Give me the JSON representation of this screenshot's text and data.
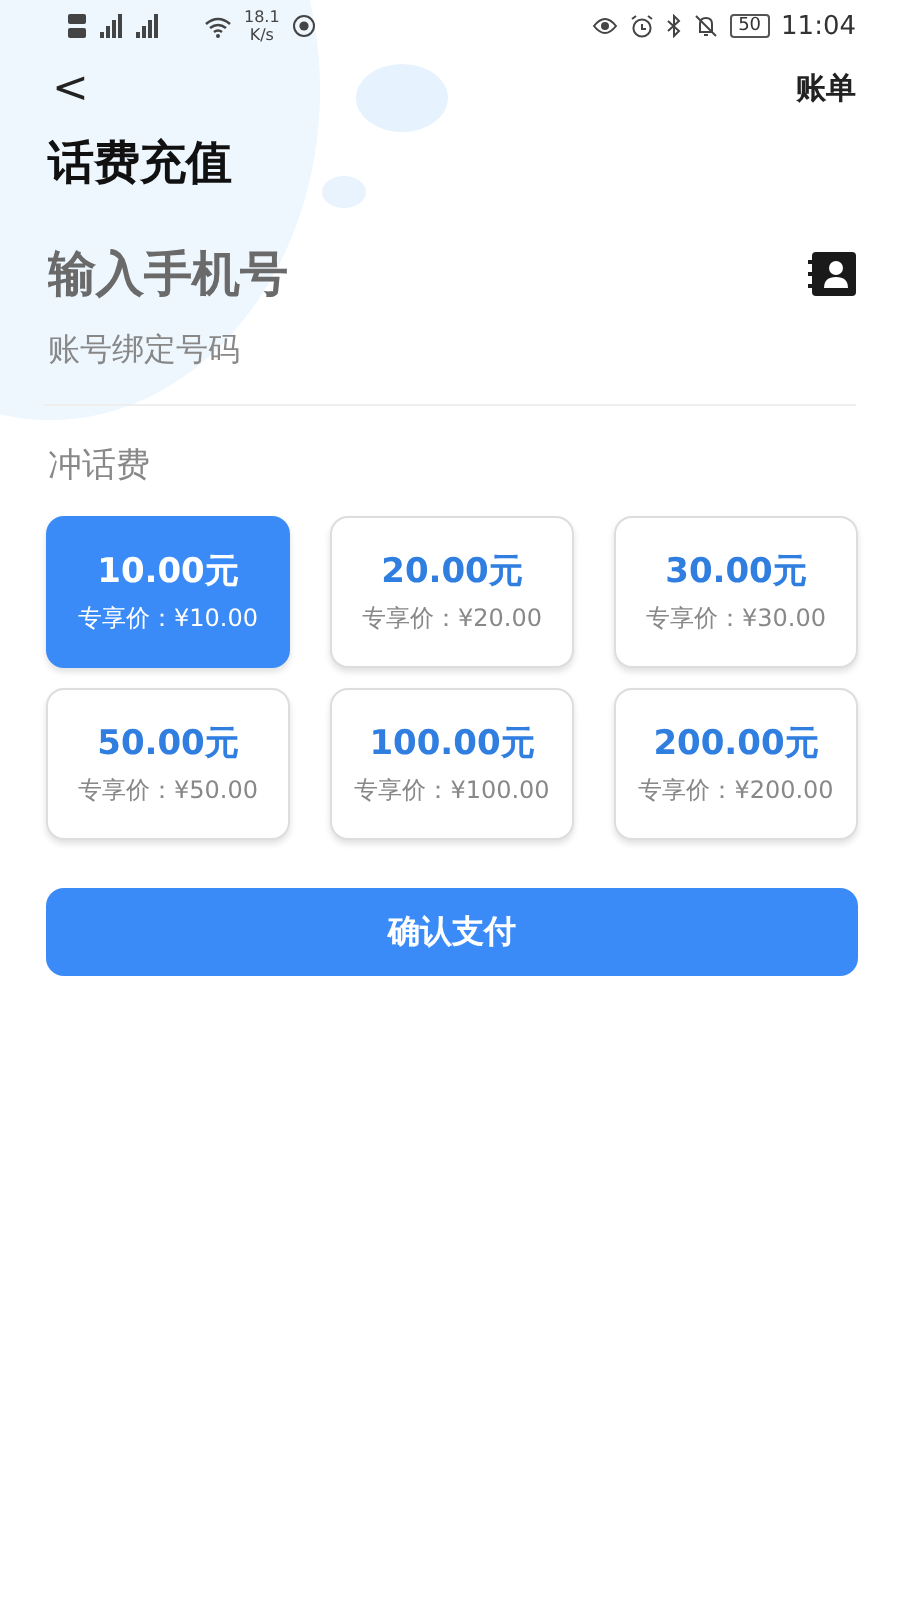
{
  "status_bar": {
    "network_speed": "18.1",
    "speed_unit": "K/s",
    "battery": "50",
    "time": "11:04"
  },
  "nav": {
    "back": "<",
    "bill_link": "账单"
  },
  "title": "话费充值",
  "phone_input": {
    "placeholder": "输入手机号",
    "hint": "账号绑定号码"
  },
  "section_label": "冲话费",
  "options": [
    {
      "amount": "10.00元",
      "price": "专享价：¥10.00",
      "selected": true
    },
    {
      "amount": "20.00元",
      "price": "专享价：¥20.00",
      "selected": false
    },
    {
      "amount": "30.00元",
      "price": "专享价：¥30.00",
      "selected": false
    },
    {
      "amount": "50.00元",
      "price": "专享价：¥50.00",
      "selected": false
    },
    {
      "amount": "100.00元",
      "price": "专享价：¥100.00",
      "selected": false
    },
    {
      "amount": "200.00元",
      "price": "专享价：¥200.00",
      "selected": false
    }
  ],
  "confirm_button": "确认支付"
}
